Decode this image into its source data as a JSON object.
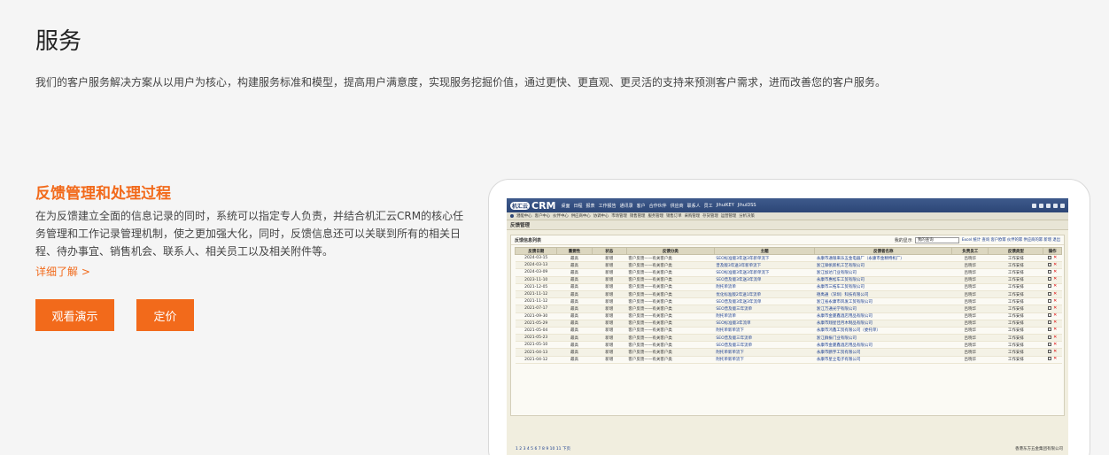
{
  "page": {
    "title": "服务",
    "intro": "我们的客户服务解决方案从以用户为核心，构建服务标准和模型，提高用户满意度，实现服务挖掘价值，通过更快、更直观、更灵活的支持来预测客户需求，进而改善您的客户服务。"
  },
  "section": {
    "title": "反馈管理和处理过程",
    "description": "在为反馈建立全面的信息记录的同时，系统可以指定专人负责，并结合机汇云CRM的核心任务管理和工作记录管理机制，使之更加强大化，同时，反馈信息还可以关联到所有的相关日程、待办事宜、销售机会、联系人、相关员工以及相关附件等。",
    "more_link": "详细了解 >",
    "demo_button": "观看演示",
    "price_button": "定价"
  },
  "crm": {
    "logo_mark": "机汇云",
    "logo_text": "CRM",
    "top_menu": [
      "桌面",
      "日程",
      "报表",
      "工作报告",
      "通讯录",
      "客户",
      "合作伙伴",
      "供应商",
      "联系人",
      "员工",
      "JihuiKEY",
      "JihuiDSS"
    ],
    "nav_items": [
      "潜能中心",
      "客户中心",
      "伙伴中心",
      "供应商中心",
      "协调中心",
      "市场管理",
      "销售管理",
      "服务管理",
      "销售订单",
      "采购管理",
      "存货管理",
      "运营管理",
      "分析决策"
    ],
    "module_title": "反馈管理",
    "panel_title": "反馈信息列表",
    "filter_label": "我的显示",
    "filter_value": "我的查询",
    "toolbar_links": "Excel 统计 查询 客户欧幂 伙伴的幂 供应商的幂 新增 退出",
    "columns": [
      "反馈日期",
      "重要性",
      "状态",
      "反馈分类",
      "主题",
      "反馈者名称",
      "负责员工",
      "反馈类型",
      "操作"
    ],
    "rows": [
      [
        "2024-03-15",
        "最高",
        "新增",
        "客户反馈——有关客户类",
        "SEO标准版3年送3年新单流下",
        "永康市通银来乐五金电器厂（永康市金精特机厂）",
        "吕晓华",
        "工作安排"
      ],
      [
        "2024-03-13",
        "最高",
        "新增",
        "客户反馈——有关客户类",
        "普及版3年送3年新单流下",
        "浙江锋帆新机工艺有限公司",
        "吕晓华",
        "工作安排"
      ],
      [
        "2024-03-09",
        "最高",
        "新增",
        "客户反馈——有关客户类",
        "SEO标准版3年送3年新单流下",
        "浙江加达门业有限公司",
        "吕晓华",
        "工作安排"
      ],
      [
        "2023-11-10",
        "最高",
        "新增",
        "客户反馈——有关客户类",
        "SEO普及版3年送3年流单",
        "永康市惠松车工贸有限公司",
        "吕晓华",
        "工作安排"
      ],
      [
        "2021-12-05",
        "最高",
        "新增",
        "客户反馈——有关客户类",
        "附托单流单",
        "永康市三拓车工贸有限公司",
        "吕晓华",
        "工作安排"
      ],
      [
        "2021-11-12",
        "最高",
        "新增",
        "客户反馈——有关客户类",
        "优化标准版2年送1年流单",
        "德禹通（深圳）科技有限公司",
        "吕晓华",
        "工作安排"
      ],
      [
        "2021-11-12",
        "最高",
        "新增",
        "客户反馈——有关客户类",
        "SEO普及版3年送3年流单",
        "浙江省永康市风发工贸有限公司",
        "吕晓华",
        "工作安排"
      ],
      [
        "2021-07-17",
        "最高",
        "新增",
        "客户反馈——有关客户类",
        "SEO普及版三年流单",
        "浙江万通光学有限公司",
        "吕晓华",
        "工作安排"
      ],
      [
        "2021-09-30",
        "最高",
        "新增",
        "客户反馈——有关客户类",
        "附托单流单",
        "永康市金厦鑫酒店用品有限公司",
        "吕晓华",
        "工作安排"
      ],
      [
        "2021-05-29",
        "最高",
        "新增",
        "客户反馈——有关客户类",
        "SEO标准版3年流单",
        "永康市翔星佳月木制品有限公司",
        "吕晓华",
        "工作安排"
      ],
      [
        "2021-05-04",
        "最高",
        "新增",
        "客户反馈——有关客户类",
        "附托单新单流下",
        "永康市鸿鑫工贸有限公司（委托单）",
        "吕晓华",
        "工作安排"
      ],
      [
        "2021-05-23",
        "最高",
        "新增",
        "客户反馈——有关客户类",
        "SEO普及版三年流单",
        "浙江群振门业有限公司",
        "吕晓华",
        "工作安排"
      ],
      [
        "2021-05-10",
        "最高",
        "新增",
        "客户反馈——有关客户类",
        "SEO普及版三年流单",
        "永康市金厦鑫酒店用品有限公司",
        "吕晓华",
        "工作安排"
      ],
      [
        "2021-04-13",
        "最高",
        "新增",
        "客户反馈——有关客户类",
        "附托单新单流下",
        "永康市鹏宇工贸有限公司",
        "吕晓华",
        "工作安排"
      ],
      [
        "2021-04-12",
        "最高",
        "新增",
        "客户反馈——有关客户类",
        "附托单新单流下",
        "永康市星立电子有限公司",
        "吕晓华",
        "工作安排"
      ]
    ],
    "pager": "1 2 3 4 5 6 7 8 9 10 11  下页",
    "footer_company": "香港东方五金集团有限公司"
  }
}
